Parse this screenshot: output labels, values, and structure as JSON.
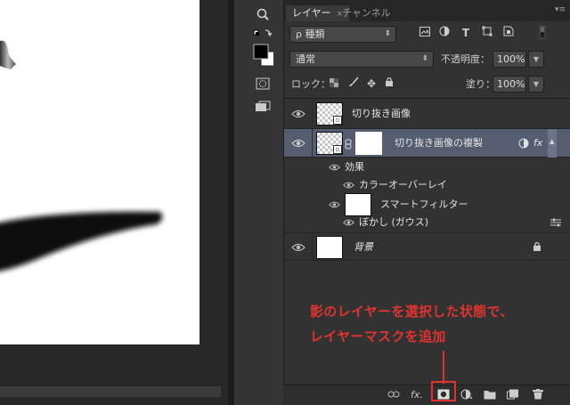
{
  "panel": {
    "tabs": [
      {
        "label": "レイヤー",
        "close": "×"
      },
      {
        "label": "チャンネル"
      }
    ],
    "menu_icon": "panel-menu-icon"
  },
  "filter": {
    "kind_prefix": "ρ",
    "kind_label": "種類",
    "arrow": "⬍"
  },
  "blend": {
    "mode": "通常",
    "opacity_label": "不透明度：",
    "opacity_value": "100%"
  },
  "lock": {
    "label": "ロック：",
    "fill_label": "塗り：",
    "fill_value": "100%"
  },
  "layers": [
    {
      "name": "切り抜き画像",
      "type": "smart-object"
    },
    {
      "name": "切り抜き画像の複製",
      "type": "smart-object",
      "selected": true,
      "fx": "fx",
      "effects_label": "効果",
      "effects": [
        "カラーオーバーレイ"
      ],
      "smart_filter_label": "スマートフィルター",
      "filters": [
        "ぼかし (ガウス)"
      ]
    },
    {
      "name": "背景",
      "type": "background",
      "locked": true
    }
  ],
  "bottom_bar": {
    "fx_label": "fx."
  },
  "callout": {
    "line1": "影のレイヤーを選択した状態で、",
    "line2": "レイヤーマスクを追加"
  },
  "colors": {
    "accent": "#e0332f",
    "panel_bg": "#323232",
    "selected_row": "#555d71"
  }
}
